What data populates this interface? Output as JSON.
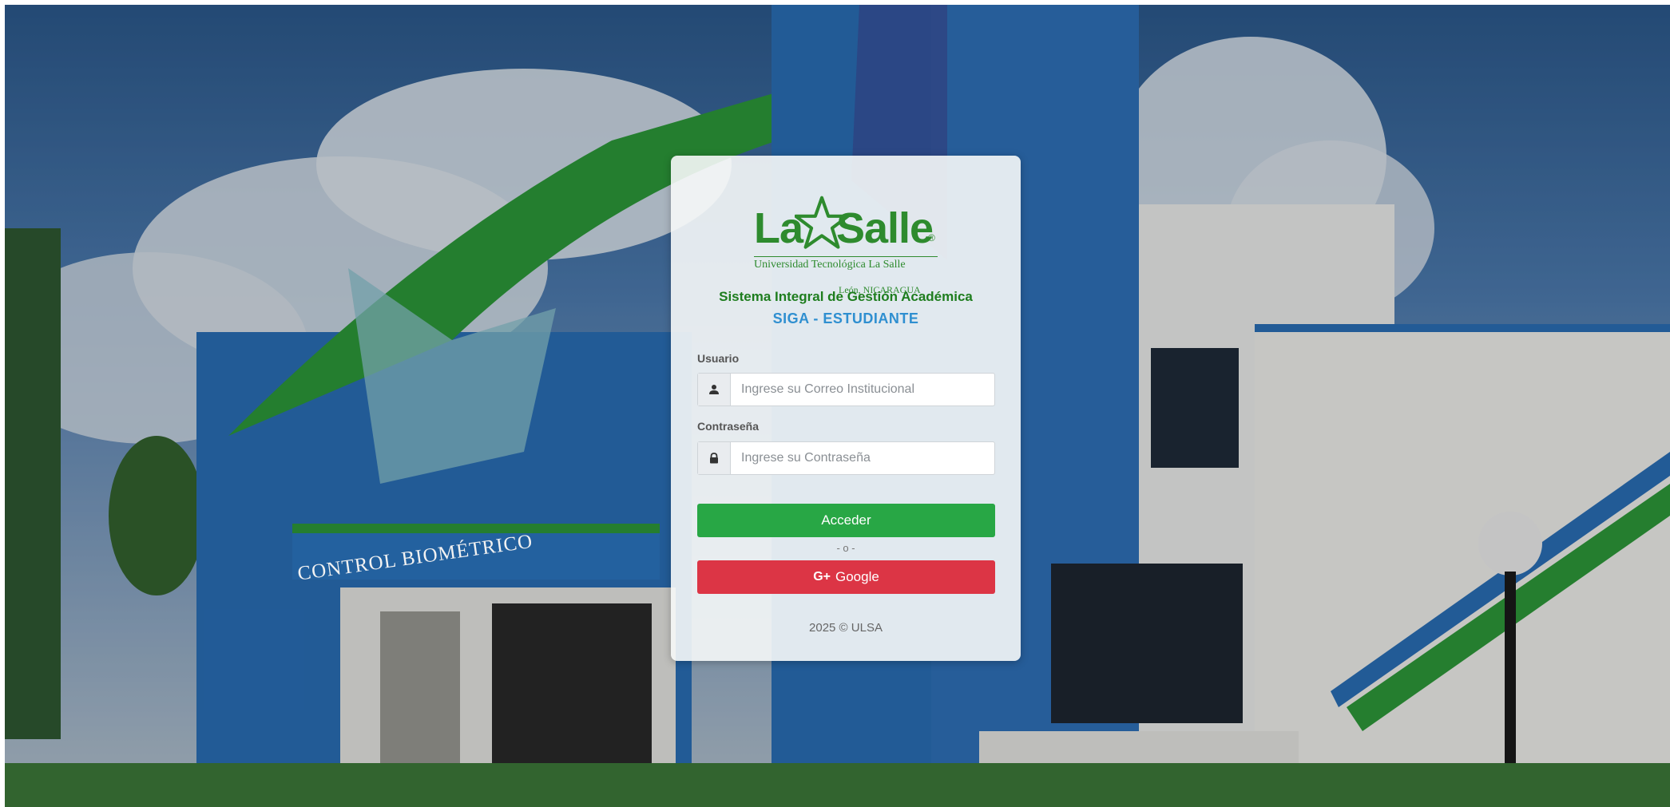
{
  "colors": {
    "primary_green": "#28a745",
    "google_red": "#dc3545",
    "title_green": "#1e7d1e",
    "subtitle_blue": "#2f8fd0",
    "logo_green": "#2e8b2e"
  },
  "background": {
    "signage_text": "CONTROL BIOMÉTRICO"
  },
  "logo": {
    "brand_left": "La",
    "brand_right": "Salle",
    "registered": "®",
    "university": "Universidad Tecnológica La Salle",
    "location": "León, NICARAGUA"
  },
  "header": {
    "system_title": "Sistema Integral de Gestión Académica",
    "system_subtitle": "SIGA - ESTUDIANTE"
  },
  "form": {
    "user_label": "Usuario",
    "user_placeholder": "Ingrese su Correo Institucional",
    "user_value": "",
    "user_icon": "user-icon",
    "password_label": "Contraseña",
    "password_placeholder": "Ingrese su Contraseña",
    "password_value": "",
    "password_icon": "lock-icon",
    "login_button": "Acceder",
    "separator": "- o -",
    "google_icon": "G+",
    "google_button": "Google"
  },
  "footer": {
    "copyright": "2025 © ULSA"
  }
}
